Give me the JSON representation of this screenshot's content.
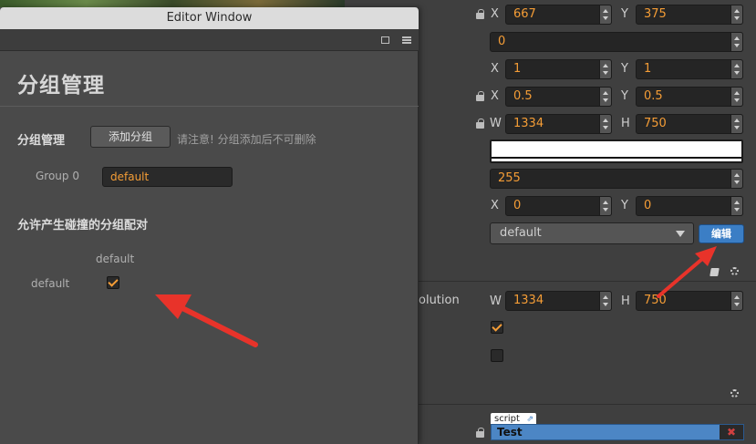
{
  "inspector": {
    "position": {
      "x_label": "X",
      "x_value": "667",
      "y_label": "Y",
      "y_value": "375"
    },
    "rotation": {
      "value": "0"
    },
    "scale": {
      "x_label": "X",
      "x_value": "1",
      "y_label": "Y",
      "y_value": "1"
    },
    "anchor": {
      "x_label": "X",
      "x_value": "0.5",
      "y_label": "Y",
      "y_value": "0.5"
    },
    "size": {
      "w_label": "W",
      "w_value": "1334",
      "h_label": "H",
      "h_value": "750"
    },
    "color": "#ffffff",
    "opacity": {
      "value": "255"
    },
    "skew": {
      "x_label": "X",
      "x_value": "0",
      "y_label": "Y",
      "y_value": "0"
    },
    "group": {
      "selected": "default",
      "edit_label": "编辑"
    },
    "design_resolution": {
      "label_partial": "olution",
      "w_label": "W",
      "w_value": "1334",
      "h_label": "H",
      "h_value": "750"
    },
    "fit_height_checked": true,
    "fit_width_checked": false,
    "script": {
      "tag": "script",
      "tag_link": "⇗",
      "value": "Test",
      "remove": "✖"
    }
  },
  "editor_window": {
    "title": "Editor Window",
    "page_title": "分组管理",
    "group_section_label": "分组管理",
    "add_group_label": "添加分组",
    "hint": "请注意! 分组添加后不可删除",
    "groups": [
      {
        "label": "Group 0",
        "value": "default"
      }
    ],
    "collision_title": "允许产生碰撞的分组配对",
    "matrix": {
      "columns": [
        "default"
      ],
      "rows": [
        {
          "label": "default",
          "checked": [
            true
          ]
        }
      ]
    }
  },
  "colors": {
    "accent": "#f59d36",
    "button_blue": "#3b7ec5",
    "arrow_red": "#e8332a"
  }
}
